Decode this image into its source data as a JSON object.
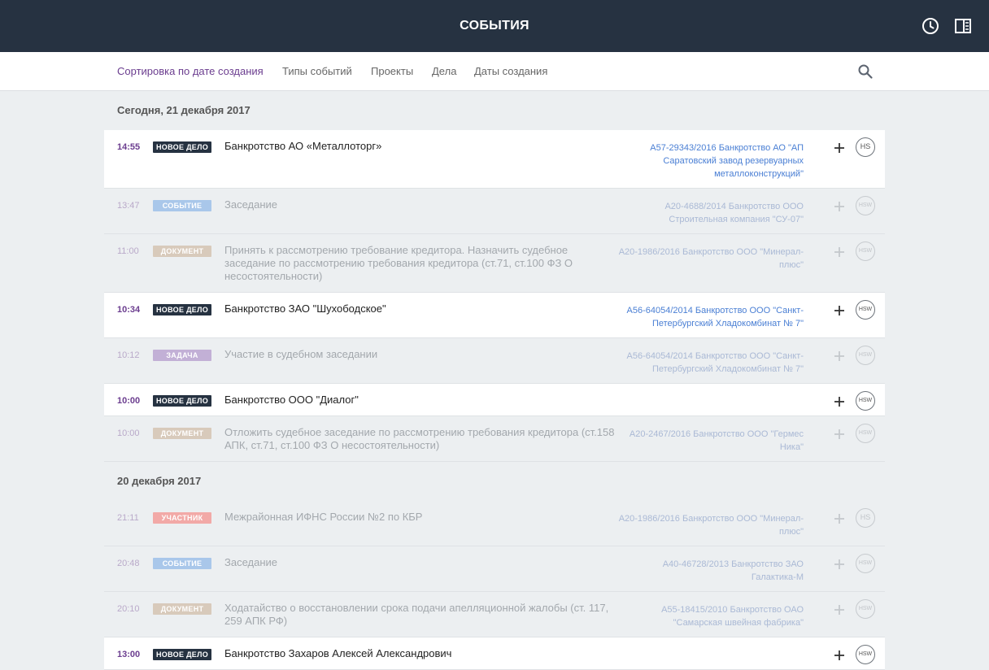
{
  "header": {
    "title": "СОБЫТИЯ",
    "icons": [
      "clock-icon",
      "panel-icon"
    ]
  },
  "subnav": {
    "tabs": [
      "Сортировка по дате создания",
      "Типы событий",
      "Проекты",
      "Дела",
      "Даты создания"
    ],
    "active_tab": "Сортировка по дате создания",
    "search_icon": "search-icon"
  },
  "badge_colors": {
    "НОВОЕ ДЕЛО": "#263241",
    "СОБЫТИЕ": "#a9c7ea",
    "ДОКУМЕНТ": "#d8cabb",
    "ЗАДАЧА": "#c2b0d6",
    "УЧАСТНИК": "#f2a9a7"
  },
  "groups": [
    {
      "date": "Сегодня, 21 декабря  2017",
      "events": [
        {
          "time": "14:55",
          "badge": "НОВОЕ ДЕЛО",
          "text": "Банкротство АО «Металлоторг»",
          "case": "А57-29343/2016 Банкротство АО \"АП Саратовский завод резервуарных металлоконструкций\"",
          "avatar": "HS",
          "active": true
        },
        {
          "time": "13:47",
          "badge": "СОБЫТИЕ",
          "text": "Заседание",
          "case": "А20-4688/2014 Банкротство ООО Строительная компания \"СУ-07\"",
          "avatar": "HSW",
          "active": false
        },
        {
          "time": "11:00",
          "badge": "ДОКУМЕНТ",
          "text": "Принять к рассмотрению требование кредитора. Назначить судебное заседание по рассмотрению требования кредитора (ст.71, ст.100 ФЗ О несостоятельности)",
          "case": "А20-1986/2016 Банкротство ООО \"Минерал-плюс\"",
          "avatar": "HSW",
          "active": false
        },
        {
          "time": "10:34",
          "badge": "НОВОЕ ДЕЛО",
          "text": "Банкротство ЗАО \"Шухободское\"",
          "case": "А56-64054/2014 Банкротство ООО \"Санкт-Петербургский Хладокомбинат № 7\"",
          "avatar": "HSW",
          "active": true
        },
        {
          "time": "10:12",
          "badge": "ЗАДАЧА",
          "text": "Участие в судебном заседании",
          "case": "А56-64054/2014 Банкротство ООО \"Санкт-Петербургский Хладокомбинат № 7\"",
          "avatar": "HSW",
          "active": false
        },
        {
          "time": "10:00",
          "badge": "НОВОЕ ДЕЛО",
          "text": "Банкротство ООО \"Диалог\"",
          "case": "",
          "avatar": "HSW",
          "active": true
        },
        {
          "time": "10:00",
          "badge": "ДОКУМЕНТ",
          "text": "Отложить судебное заседание по рассмотрению требования кредитора (ст.158 АПК, ст.71, ст.100 ФЗ О несостоятельности)",
          "case": "А20-2467/2016 Банкротство ООО \"Гермес Ника\"",
          "avatar": "HSW",
          "active": false
        }
      ]
    },
    {
      "date": "20 декабря  2017",
      "events": [
        {
          "time": "21:11",
          "badge": "УЧАСТНИК",
          "text": "Межрайонная ИФНС России №2 по КБР",
          "case": "А20-1986/2016 Банкротство ООО \"Минерал-плюс\"",
          "avatar": "HS",
          "active": false
        },
        {
          "time": "20:48",
          "badge": "СОБЫТИЕ",
          "text": "Заседание",
          "case": "А40-46728/2013 Банкротство ЗАО Галактика-М",
          "avatar": "HSW",
          "active": false
        },
        {
          "time": "20:10",
          "badge": "ДОКУМЕНТ",
          "text": "Ходатайство о восстановлении срока подачи апелляционной жалобы (ст. 117, 259 АПК РФ)",
          "case": "А55-18415/2010 Банкротство ОАО \"Самарская швейная фабрика\"",
          "avatar": "HSW",
          "active": false
        },
        {
          "time": "13:00",
          "badge": "НОВОЕ ДЕЛО",
          "text": "Банкротство Захаров Алексей Александрович",
          "case": "",
          "avatar": "HSW",
          "active": true
        }
      ]
    }
  ]
}
